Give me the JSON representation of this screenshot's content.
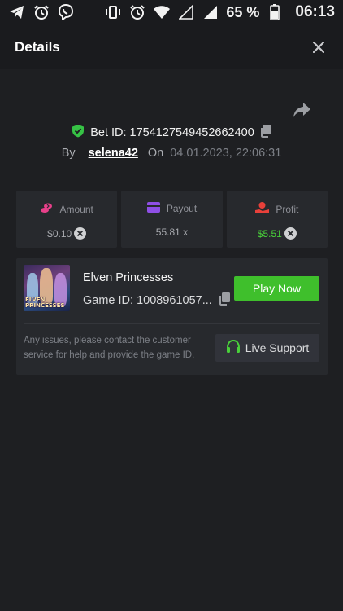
{
  "status_bar": {
    "battery_percent": "65 %",
    "time": "06:13",
    "left_icons": [
      "telegram-icon",
      "alarm-icon",
      "viber-icon"
    ],
    "right_icons": [
      "vibrate-icon",
      "alarm-icon",
      "wifi-icon",
      "signal-icon",
      "signal-icon",
      "battery-icon"
    ]
  },
  "header": {
    "title": "Details"
  },
  "bet": {
    "id_text": "Bet ID: 1754127549452662400",
    "by_label": "By",
    "username": "selena42",
    "on_label": "On",
    "date": "04.01.2023, 22:06:31"
  },
  "stats": [
    {
      "label": "Amount",
      "value": "$0.10",
      "icon": "coins-icon",
      "icon_color": "#e8408a",
      "has_currency_badge": true
    },
    {
      "label": "Payout",
      "value": "55.81 x",
      "icon": "card-icon",
      "icon_color": "#8f4fe6",
      "has_currency_badge": false
    },
    {
      "label": "Profit",
      "value": "$5.51",
      "icon": "profit-icon",
      "icon_color": "#e8403a",
      "has_currency_badge": true
    }
  ],
  "game": {
    "name": "Elven Princesses",
    "id_text": "Game ID: 1008961057...",
    "thumb_title": "ELVEN PRINCESSES",
    "play_label": "Play Now"
  },
  "support": {
    "message": "Any issues, please contact the customer service for help and provide the game ID.",
    "button_label": "Live Support"
  },
  "colors": {
    "accent_green": "#3fbf2c",
    "profit_green": "#49d03a",
    "shield_green": "#36c245"
  }
}
